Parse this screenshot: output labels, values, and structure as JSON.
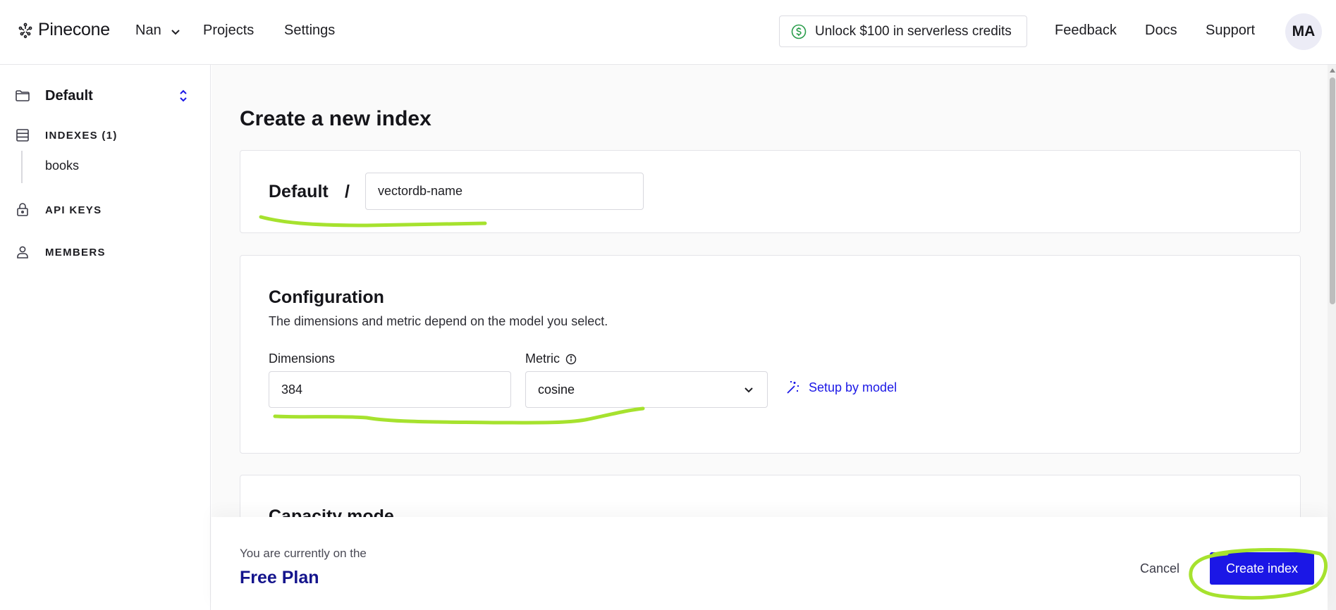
{
  "header": {
    "logo_text": "Pinecone",
    "org_name": "Nan",
    "nav": {
      "projects": "Projects",
      "settings": "Settings"
    },
    "credits_label": "Unlock $100 in serverless credits",
    "links": {
      "feedback": "Feedback",
      "docs": "Docs",
      "support": "Support"
    },
    "avatar_initials": "MA"
  },
  "sidebar": {
    "project_name": "Default",
    "indexes_label": "INDEXES (1)",
    "index_items": [
      "books"
    ],
    "api_keys_label": "API KEYS",
    "members_label": "MEMBERS"
  },
  "main": {
    "title": "Create a new index",
    "name_card": {
      "project": "Default",
      "separator": "/",
      "index_name_value": "vectordb-name"
    },
    "configuration": {
      "title": "Configuration",
      "description": "The dimensions and metric depend on the model you select.",
      "dimensions_label": "Dimensions",
      "dimensions_value": "384",
      "metric_label": "Metric",
      "metric_value": "cosine",
      "setup_link": "Setup by model"
    },
    "capacity": {
      "title": "Capacity mode"
    }
  },
  "footer": {
    "note": "You are currently on the",
    "plan": "Free Plan",
    "cancel": "Cancel",
    "create": "Create index"
  },
  "colors": {
    "accent": "#1b17e6",
    "plan_text": "#14148c",
    "annotation": "#a6e22e"
  }
}
